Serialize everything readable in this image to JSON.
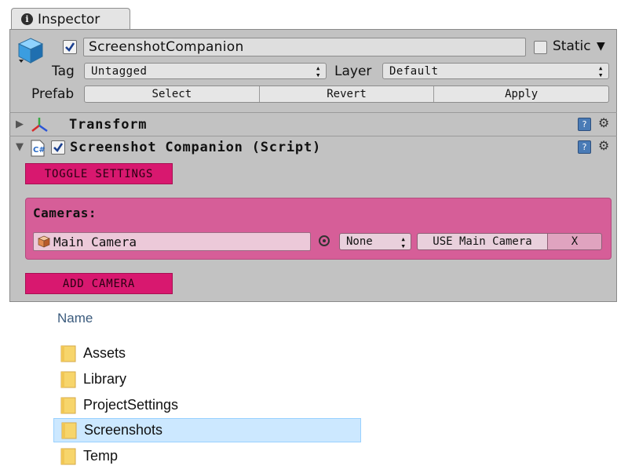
{
  "inspector": {
    "tab_label": "Inspector",
    "object_name": "ScreenshotCompanion",
    "static_label": "Static",
    "tag_label": "Tag",
    "tag_value": "Untagged",
    "layer_label": "Layer",
    "layer_value": "Default",
    "prefab_label": "Prefab",
    "prefab_buttons": {
      "select": "Select",
      "revert": "Revert",
      "apply": "Apply"
    },
    "components": {
      "transform": "Transform",
      "script": "Screenshot Companion (Script)"
    },
    "script_ui": {
      "toggle_settings": "TOGGLE SETTINGS",
      "cameras_label": "Cameras:",
      "camera_object": "Main Camera",
      "mode_value": "None",
      "use_button": "USE Main Camera",
      "remove_button": "X",
      "add_camera": "ADD CAMERA"
    },
    "colors": {
      "accent_pink": "#d8186f",
      "camera_box": "#d65e98"
    }
  },
  "explorer": {
    "column_name": "Name",
    "items": [
      {
        "label": "Assets",
        "selected": false
      },
      {
        "label": "Library",
        "selected": false
      },
      {
        "label": "ProjectSettings",
        "selected": false
      },
      {
        "label": "Screenshots",
        "selected": true
      },
      {
        "label": "Temp",
        "selected": false
      }
    ],
    "colors": {
      "selection": "#cce8ff",
      "folder": "#f7d56b"
    }
  }
}
